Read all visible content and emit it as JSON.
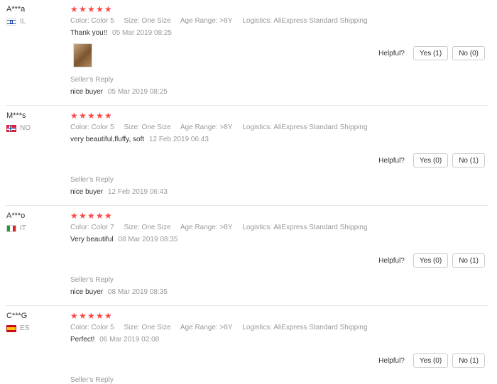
{
  "reviews": [
    {
      "user": "A***a",
      "country": "IL",
      "flag": "il",
      "meta": {
        "color": "Color: Color 5",
        "size": "Size: One Size",
        "age": "Age Range: >8Y",
        "logistics": "Logistics: AliExpress Standard Shipping"
      },
      "text": "Thank you!!",
      "date": "05 Mar 2019 08:25",
      "helpful_label": "Helpful?",
      "yes": "Yes (1)",
      "no": "No (0)",
      "seller_label": "Seller's Reply",
      "reply": "nice buyer",
      "reply_date": "05 Mar 2019 08:25",
      "rating": 5
    },
    {
      "user": "M***s",
      "country": "NO",
      "flag": "no",
      "meta": {
        "color": "Color: Color 5",
        "size": "Size: One Size",
        "age": "Age Range: >8Y",
        "logistics": "Logistics: AliExpress Standard Shipping"
      },
      "text": "very beautiful,fluffy, soft",
      "date": "12 Feb 2019 06:43",
      "helpful_label": "Helpful?",
      "yes": "Yes (0)",
      "no": "No (1)",
      "seller_label": "Seller's Reply",
      "reply": "nice buyer",
      "reply_date": "12 Feb 2019 06:43",
      "rating": 5
    },
    {
      "user": "A***o",
      "country": "IT",
      "flag": "it",
      "meta": {
        "color": "Color: Color 7",
        "size": "Size: One Size",
        "age": "Age Range: >8Y",
        "logistics": "Logistics: AliExpress Standard Shipping"
      },
      "text": "Very beautiful",
      "date": "08 Mar 2019 08:35",
      "helpful_label": "Helpful?",
      "yes": "Yes (0)",
      "no": "No (1)",
      "seller_label": "Seller's Reply",
      "reply": "nice buyer",
      "reply_date": "08 Mar 2019 08:35",
      "rating": 5
    },
    {
      "user": "C***G",
      "country": "ES",
      "flag": "es",
      "meta": {
        "color": "Color: Color 5",
        "size": "Size: One Size",
        "age": "Age Range: >8Y",
        "logistics": "Logistics: AliExpress Standard Shipping"
      },
      "text": "Perfect!",
      "date": "06 Mar 2019 02:08",
      "helpful_label": "Helpful?",
      "yes": "Yes (0)",
      "no": "No (1)",
      "seller_label": "Seller's Reply",
      "rating": 5
    }
  ],
  "star_glyph": "★",
  "star_color": "#ff4747"
}
